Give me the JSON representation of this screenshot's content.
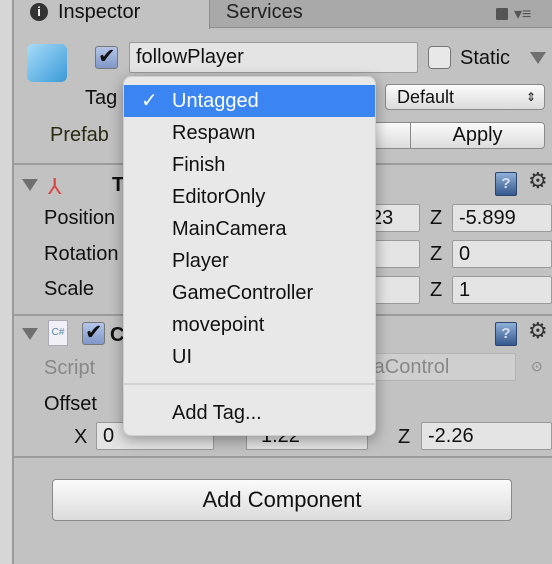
{
  "tabs": [
    {
      "label": "Inspector",
      "active": true
    },
    {
      "label": "Services",
      "active": false
    }
  ],
  "object": {
    "active": true,
    "name": "followPlayer",
    "static_label": "Static",
    "static": false,
    "tag_label": "Tag",
    "layer_value": "Default",
    "prefab_label": "Prefab",
    "apply_label": "Apply"
  },
  "tag_menu": {
    "items": [
      "Untagged",
      "Respawn",
      "Finish",
      "EditorOnly",
      "MainCamera",
      "Player",
      "GameController",
      "movepoint",
      "UI"
    ],
    "selected": "Untagged",
    "add_tag": "Add Tag..."
  },
  "transform": {
    "title_partial": "T",
    "position_label": "Position",
    "rotation_label": "Rotation",
    "scale_label": "Scale",
    "pos_y_partial": "23",
    "pos_z": "-5.899",
    "rot_z": "0",
    "scale_z": "1",
    "z_label": "Z"
  },
  "script_component": {
    "enabled": true,
    "title_partial": "C",
    "script_label": "Script",
    "script_value_partial": "raControl",
    "offset_label": "Offset",
    "x_label": "X",
    "x": "0",
    "y": "1.22",
    "z_label": "Z",
    "z": "-2.26"
  },
  "add_component": "Add Component",
  "colors": {
    "selection": "#3a85f1",
    "panel": "#c2c2c2"
  }
}
